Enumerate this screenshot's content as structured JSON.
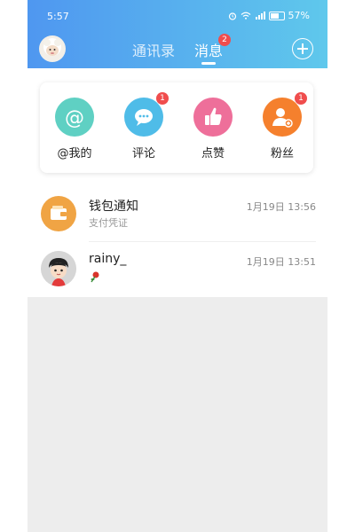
{
  "status_bar": {
    "time": "5:57",
    "battery": "57%"
  },
  "header": {
    "tabs": [
      {
        "label": "通讯录",
        "active": false
      },
      {
        "label": "消息",
        "active": true,
        "badge": "2"
      }
    ]
  },
  "quick_actions": [
    {
      "label": "@我的",
      "icon": "at-icon",
      "color": "#5fd0c3",
      "badge": ""
    },
    {
      "label": "评论",
      "icon": "comment-icon",
      "color": "#4fbce8",
      "badge": "1"
    },
    {
      "label": "点赞",
      "icon": "thumb-up-icon",
      "color": "#ee6f9a",
      "badge": ""
    },
    {
      "label": "粉丝",
      "icon": "fan-user-icon",
      "color": "#f5802d",
      "badge": "1"
    }
  ],
  "conversations": [
    {
      "title": "钱包通知",
      "subtitle": "支付凭证",
      "time": "1月19日 13:56",
      "avatar_icon": "wallet-icon"
    },
    {
      "title": "rainy_",
      "subtitle": "",
      "time": "1月19日 13:51",
      "avatar_icon": "user-avatar",
      "subtitle_icon": "rose-icon"
    }
  ]
}
